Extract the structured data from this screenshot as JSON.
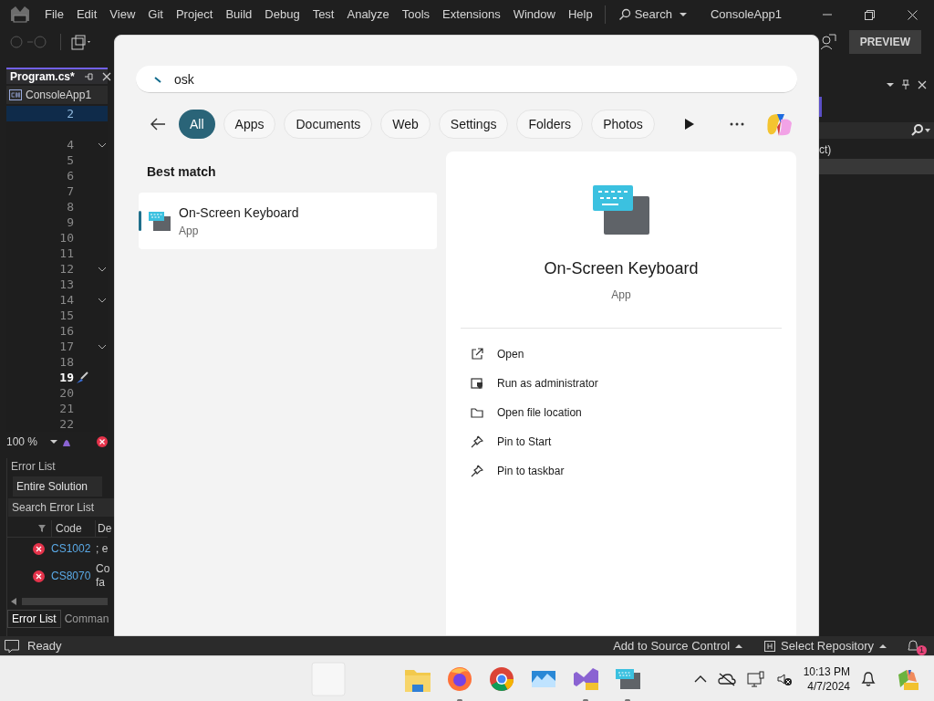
{
  "menu_bar": {
    "items": [
      "File",
      "Edit",
      "View",
      "Git",
      "Project",
      "Build",
      "Debug",
      "Test",
      "Analyze",
      "Tools",
      "Extensions",
      "Window",
      "Help"
    ],
    "search": "Search",
    "solution_name": "ConsoleApp1"
  },
  "toolbar": {
    "preview_button": "PREVIEW"
  },
  "editor": {
    "tab": {
      "title": "Program.cs*"
    },
    "project": "ConsoleApp1",
    "lines": [
      {
        "number": "2",
        "kind": "sticky",
        "foldable": false
      },
      {
        "number": "4",
        "kind": "normal",
        "foldable": true
      },
      {
        "number": "5",
        "kind": "normal",
        "foldable": false
      },
      {
        "number": "6",
        "kind": "normal",
        "foldable": false
      },
      {
        "number": "7",
        "kind": "normal",
        "foldable": false
      },
      {
        "number": "8",
        "kind": "normal",
        "foldable": false
      },
      {
        "number": "9",
        "kind": "normal",
        "foldable": false
      },
      {
        "number": "10",
        "kind": "normal",
        "foldable": false
      },
      {
        "number": "11",
        "kind": "normal",
        "foldable": false
      },
      {
        "number": "12",
        "kind": "normal",
        "foldable": true
      },
      {
        "number": "13",
        "kind": "normal",
        "foldable": false
      },
      {
        "number": "14",
        "kind": "normal",
        "foldable": true
      },
      {
        "number": "15",
        "kind": "normal",
        "foldable": false
      },
      {
        "number": "16",
        "kind": "normal",
        "foldable": false
      },
      {
        "number": "17",
        "kind": "normal",
        "foldable": true
      },
      {
        "number": "18",
        "kind": "normal",
        "foldable": false
      },
      {
        "number": "19",
        "kind": "current",
        "foldable": false
      },
      {
        "number": "20",
        "kind": "normal",
        "foldable": false
      },
      {
        "number": "21",
        "kind": "normal",
        "foldable": false
      },
      {
        "number": "22",
        "kind": "normal",
        "foldable": false
      }
    ],
    "zoom": "100 %"
  },
  "error_list": {
    "title": "Error List",
    "scope": "Entire Solution",
    "search_placeholder": "Search Error List",
    "columns": [
      "Code",
      "De"
    ],
    "rows": [
      {
        "code": "CS1002",
        "description": "; e"
      },
      {
        "code": "CS8070",
        "description": "Co fa"
      }
    ],
    "tabs": [
      {
        "label": "Error List",
        "selected": true
      },
      {
        "label": "Comman",
        "selected": false
      }
    ]
  },
  "right_panel": {
    "text": "ct)"
  },
  "search_popup": {
    "query": "osk",
    "filters": [
      {
        "label": "All",
        "selected": true
      },
      {
        "label": "Apps",
        "selected": false
      },
      {
        "label": "Documents",
        "selected": false
      },
      {
        "label": "Web",
        "selected": false
      },
      {
        "label": "Settings",
        "selected": false
      },
      {
        "label": "Folders",
        "selected": false
      },
      {
        "label": "Photos",
        "selected": false
      }
    ],
    "best_match_heading": "Best match",
    "results": [
      {
        "name": "On-Screen Keyboard",
        "type": "App",
        "selected": true
      }
    ],
    "details": {
      "name": "On-Screen Keyboard",
      "type": "App",
      "actions": [
        {
          "kind": "open",
          "label": "Open"
        },
        {
          "kind": "admin",
          "label": "Run as administrator"
        },
        {
          "kind": "folder",
          "label": "Open file location"
        },
        {
          "kind": "pin",
          "label": "Pin to Start"
        },
        {
          "kind": "pin",
          "label": "Pin to taskbar"
        }
      ]
    }
  },
  "status_bar": {
    "status": "Ready",
    "source_control": "Add to Source Control",
    "repository": "Select Repository",
    "notification_count": "1"
  },
  "taskbar": {
    "apps": [
      {
        "kind": "widget",
        "running": false
      },
      {
        "kind": "folder",
        "running": false
      },
      {
        "kind": "firefox",
        "running": true
      },
      {
        "kind": "chrome",
        "running": false
      },
      {
        "kind": "photos",
        "running": false
      },
      {
        "kind": "vs",
        "running": true
      },
      {
        "kind": "keyboard",
        "running": true
      }
    ],
    "time": "10:13 PM",
    "date": "4/7/2024"
  }
}
